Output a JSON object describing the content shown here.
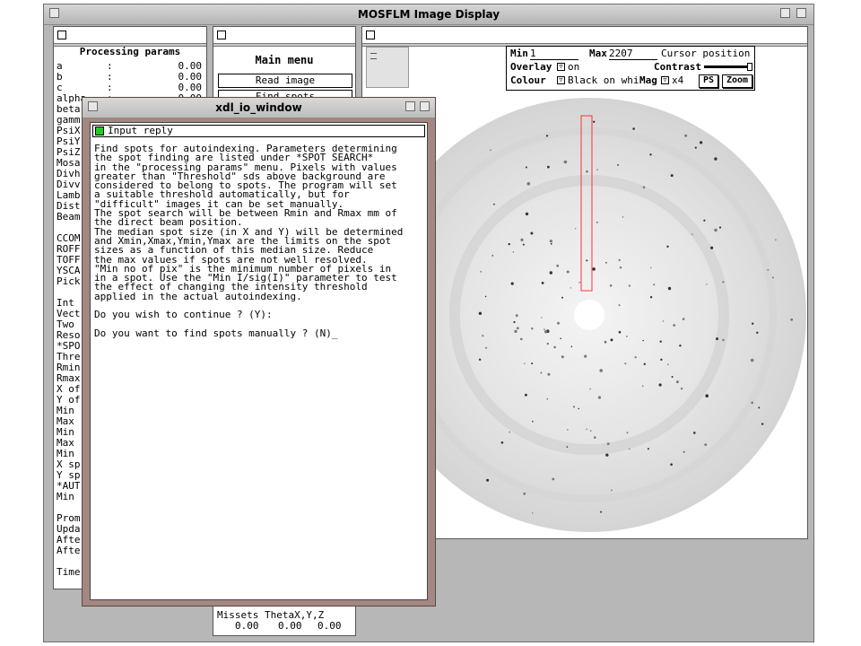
{
  "main_window": {
    "title": "MOSFLM Image Display"
  },
  "params": {
    "title": "Processing params",
    "rows": [
      {
        "name": "a",
        "colon": ":",
        "value": "0.00"
      },
      {
        "name": "b",
        "colon": ":",
        "value": "0.00"
      },
      {
        "name": "c",
        "colon": ":",
        "value": "0.00"
      },
      {
        "name": "alpha",
        "colon": ":",
        "value": "0.00"
      }
    ],
    "truncated": [
      "beta",
      "gamm",
      "PsiX",
      "PsiY",
      "PsiZ",
      "Mosa",
      "Divh",
      "Divv",
      "Lamb",
      "Dist",
      "Beam",
      "",
      "CCOM",
      "ROFF",
      "TOFF",
      "YSCA",
      "Pick",
      "",
      "Int",
      "Vect",
      "Two",
      "Reso",
      "*SPO",
      "Thre",
      "Rmin",
      "Rmax",
      "X of",
      "Y of",
      "Min",
      "Max",
      "Min",
      "Max",
      "Min",
      "X sp",
      "Y sp",
      "*AUT",
      "Min",
      "",
      "Prom",
      "Upda",
      "Afte",
      "Afte",
      "",
      "Time"
    ]
  },
  "menu": {
    "title": "Main menu",
    "items": [
      "Read image",
      "Find spots"
    ]
  },
  "missets": {
    "label": "Missets ThetaX,Y,Z",
    "values": [
      "0.00",
      "0.00",
      "0.00"
    ]
  },
  "controls": {
    "min_label": "Min",
    "min_value": "1",
    "max_label": "Max",
    "max_value": "2207",
    "cursor_label": "Cursor position",
    "overlay_label": "Overlay",
    "overlay_value": "on",
    "contrast_label": "Contrast",
    "colour_label": "Colour",
    "colour_value": "Black on whi",
    "mag_label": "Mag",
    "mag_value": "x4",
    "ps_button": "PS",
    "zoom_button": "Zoom",
    "dropdown_glyph": "▽"
  },
  "io_window": {
    "title": "xdl_io_window",
    "input_label": "Input reply",
    "lines": [
      "Find spots for autoindexing. Parameters determining",
      "the spot finding are listed under *SPOT SEARCH*",
      "in the \"processing params\" menu. Pixels with values",
      "greater than \"Threshold\" sds above background are",
      "considered to belong to spots. The program will set",
      "a suitable threshold automatically, but for",
      "\"difficult\" images it can be set manually.",
      "The spot search will be between Rmin and Rmax mm of",
      "the direct beam position.",
      "The median spot size (in X and Y) will be determined",
      "and Xmin,Xmax,Ymin,Ymax are the limits on the spot",
      "sizes as a function of this median size. Reduce",
      "the max values if spots are not well resolved.",
      "\"Min no of pix\" is the minimum number of pixels in",
      "in a spot. Use the \"Min I/sig(I)\" parameter to test",
      "the effect of changing the intensity threshold",
      "applied in the actual autoindexing.",
      "",
      "Do you wish to continue ? (Y):",
      "",
      "Do you want to find spots manually ? (N)_"
    ]
  },
  "colors": {
    "frame_bg": "#b7b7b7",
    "io_window_border": "#a48780",
    "input_indicator": "#22cc22",
    "selection_box": "#ff3333",
    "diffraction_bg": "#dcdcdc"
  }
}
